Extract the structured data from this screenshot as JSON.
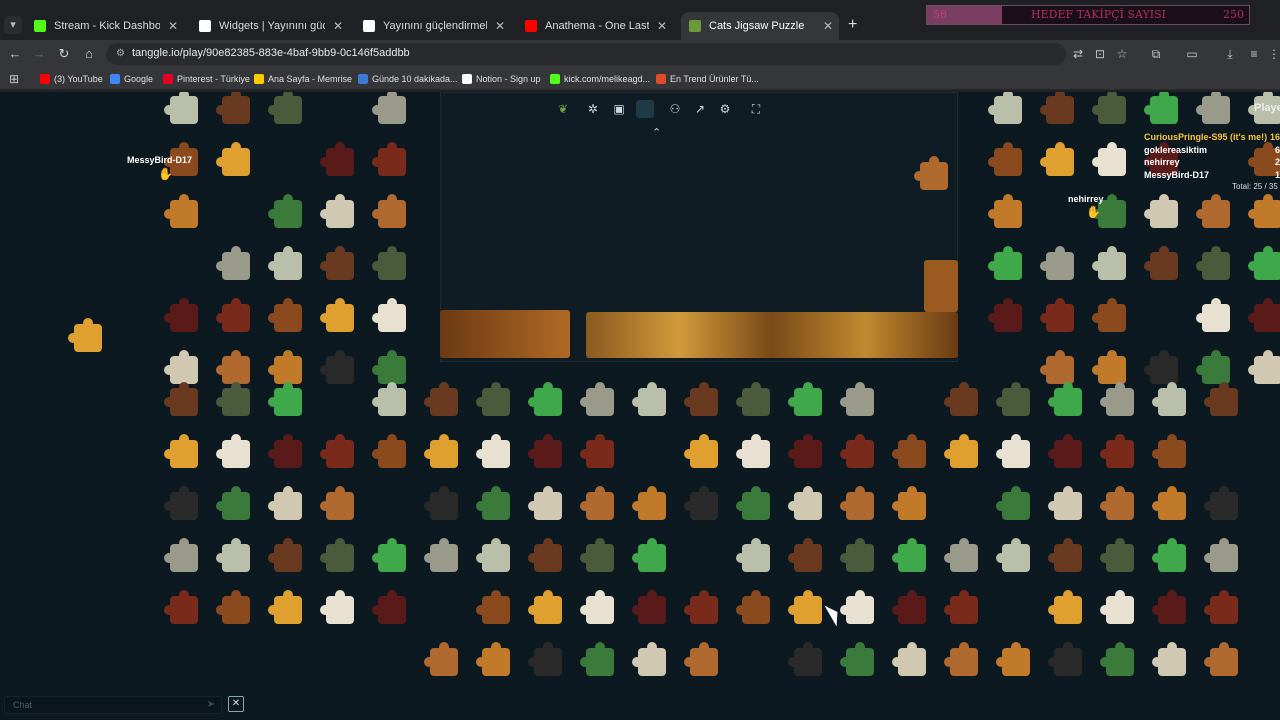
{
  "browser": {
    "tabs": [
      {
        "title": "Stream - Kick Dashboard",
        "icon": "kick-icon",
        "color": "#53fc18",
        "active": false
      },
      {
        "title": "Widgets | Yayınını güçlendirme",
        "icon": "diamond-icon",
        "color": "#ffffff",
        "active": false
      },
      {
        "title": "Yayınını güçlendirmek için",
        "icon": "diamond-icon",
        "color": "#ffffff",
        "active": false
      },
      {
        "title": "Anathema - One Last Goodbye",
        "icon": "youtube-icon",
        "color": "#ff0000",
        "active": false
      },
      {
        "title": "Cats Jigsaw Puzzle",
        "icon": "tanggle-leaf-icon",
        "color": "#6a9a3a",
        "active": true
      }
    ],
    "url": "tanggle.io/play/90e82385-883e-4baf-9bb9-0c146f5addbb",
    "bookmarks": [
      {
        "label": "(3) YouTube",
        "icon": "youtube-icon",
        "color": "#ff0000"
      },
      {
        "label": "Google",
        "icon": "google-icon",
        "color": "#4285f4"
      },
      {
        "label": "Pinterest - Türkiye",
        "icon": "pinterest-icon",
        "color": "#e60023"
      },
      {
        "label": "Ana Sayfa - Memrise",
        "icon": "memrise-icon",
        "color": "#ffcc00"
      },
      {
        "label": "Günde 10 dakikada...",
        "icon": "page-icon",
        "color": "#3a7bd5"
      },
      {
        "label": "Notion - Sign up",
        "icon": "notion-icon",
        "color": "#ffffff"
      },
      {
        "label": "kick.com/melikeagd...",
        "icon": "kick-icon",
        "color": "#53fc18"
      },
      {
        "label": "En Trend Ürünler Tü...",
        "icon": "trend-icon",
        "color": "#e04b2b"
      }
    ]
  },
  "follow_goal": {
    "current": "58",
    "label": "HEDEF TAKİPÇİ SAYISI",
    "target": "250",
    "progress": 0.232
  },
  "game": {
    "players_title": "Playe",
    "players": [
      {
        "name": "CuriousPringle-S95 (it's me!)",
        "count": "16",
        "color": "#f5c542"
      },
      {
        "name": "goklereasiktim",
        "count": "6",
        "color": "#ffffff"
      },
      {
        "name": "nehirrey",
        "count": "2",
        "color": "#ffffff"
      },
      {
        "name": "MessyBird-D17",
        "count": "1",
        "color": "#ffffff"
      }
    ],
    "total": "Total: 25 / 35",
    "cursors": [
      {
        "name": "MessyBird-D17"
      },
      {
        "name": "nehirrey"
      }
    ],
    "chat_placeholder": "Chat"
  }
}
